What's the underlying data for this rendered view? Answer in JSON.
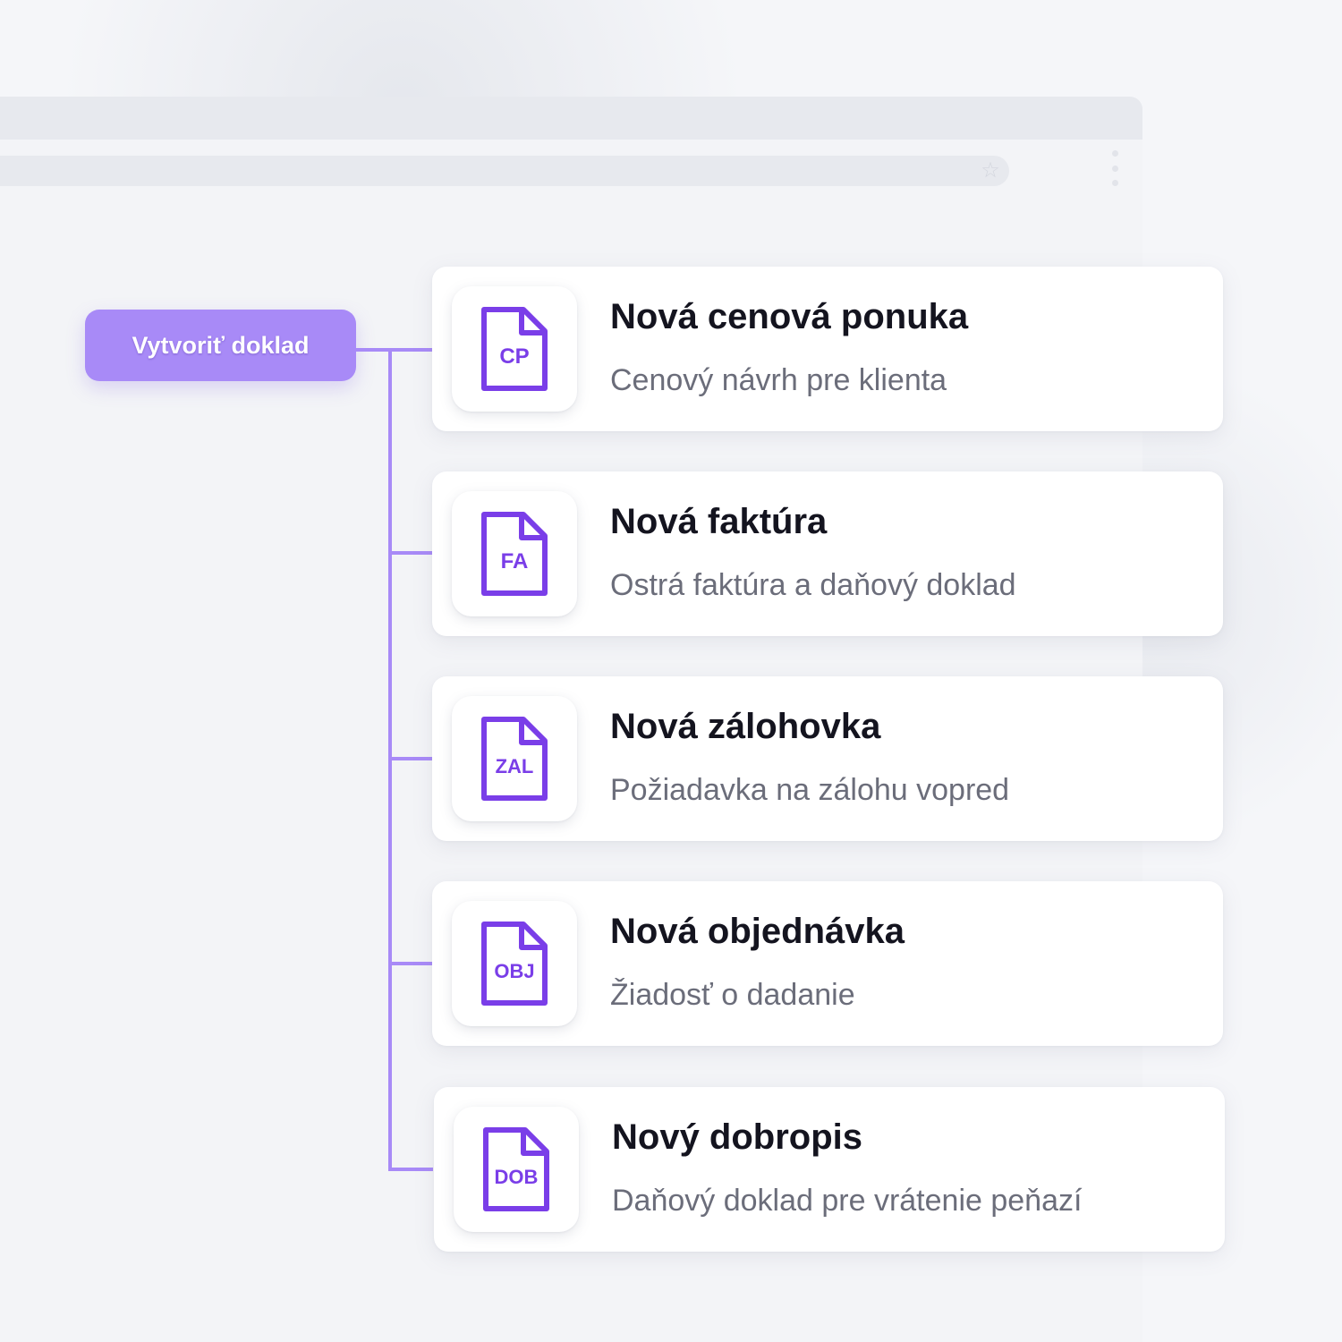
{
  "accent_color": "#a88af7",
  "icon_color": "#7a3ee8",
  "browser": {
    "star_icon": "star-icon",
    "menu_icon": "kebab-icon"
  },
  "create_button": {
    "label": "Vytvoriť doklad"
  },
  "documents": [
    {
      "badge": "CP",
      "title": "Nová cenová ponuka",
      "subtitle": "Cenový návrh pre klienta"
    },
    {
      "badge": "FA",
      "title": "Nová faktúra",
      "subtitle": "Ostrá faktúra a daňový doklad"
    },
    {
      "badge": "ZAL",
      "title": "Nová zálohovka",
      "subtitle": "Požiadavka na zálohu vopred"
    },
    {
      "badge": "OBJ",
      "title": "Nová objednávka",
      "subtitle": "Žiadosť o dadanie"
    },
    {
      "badge": "DOB",
      "title": "Nový dobropis",
      "subtitle": "Daňový doklad pre vrátenie peňazí"
    }
  ]
}
